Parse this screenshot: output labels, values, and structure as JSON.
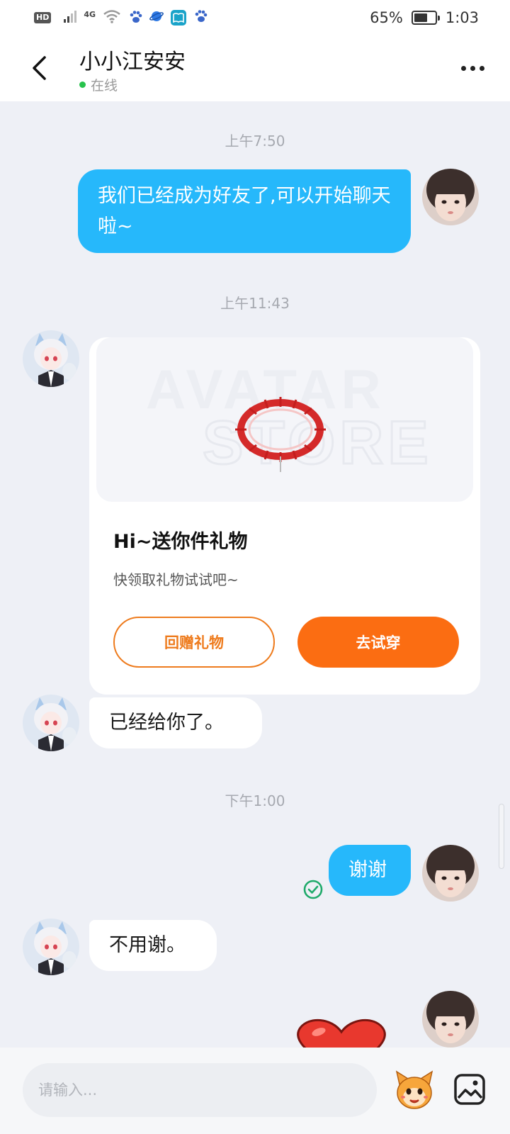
{
  "status_bar": {
    "hd": "HD",
    "network": "4G",
    "battery": "65%",
    "battery_level": 0.65,
    "time": "1:03"
  },
  "header": {
    "contact_name": "小小江安安",
    "online_status": "在线"
  },
  "messages": {
    "time_1": "上午7:50",
    "sent_1": "我们已经成为好友了,可以开始聊天啦~",
    "time_2": "上午11:43",
    "gift_card": {
      "title": "Hi~送你件礼物",
      "subtitle": "快领取礼物试试吧~",
      "return_gift_label": "回赠礼物",
      "try_on_label": "去试穿",
      "image_watermark": "AVATAR STORE"
    },
    "recv_2": "已经给你了。",
    "time_3": "下午1:00",
    "sent_2": "谢谢",
    "recv_3": "不用谢。"
  },
  "input_bar": {
    "placeholder": "请输入..."
  },
  "colors": {
    "sent_bubble": "#26b8fb",
    "accent_orange": "#fb6d12",
    "background": "#eef0f6",
    "online_dot": "#27c24c"
  },
  "icons": [
    "back-icon",
    "more-icon",
    "read-check-icon",
    "emoji-sticker-icon",
    "image-icon"
  ]
}
